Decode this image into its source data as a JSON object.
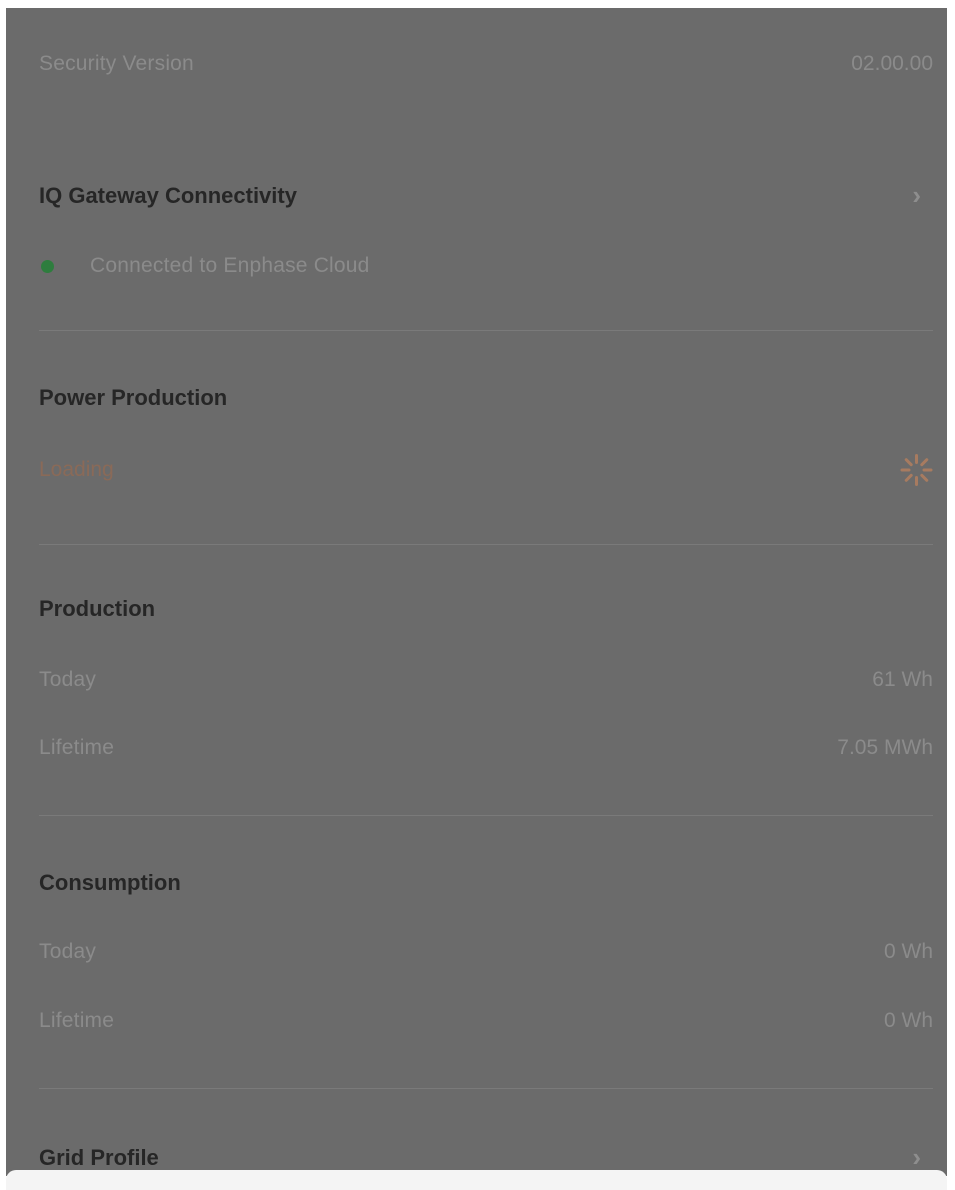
{
  "security": {
    "label": "Security Version",
    "value": "02.00.00"
  },
  "gateway": {
    "title": "IQ Gateway Connectivity",
    "status_text": "Connected to Enphase Cloud",
    "status_color": "#2e7d3e"
  },
  "power_production": {
    "title": "Power Production",
    "status": "Loading",
    "spinner_icon": "loading-spinner-icon"
  },
  "production": {
    "title": "Production",
    "today_label": "Today",
    "today_value": "61 Wh",
    "lifetime_label": "Lifetime",
    "lifetime_value": "7.05 MWh"
  },
  "consumption": {
    "title": "Consumption",
    "today_label": "Today",
    "today_value": "0 Wh",
    "lifetime_label": "Lifetime",
    "lifetime_value": "0 Wh"
  },
  "grid_profile": {
    "title": "Grid Profile"
  },
  "colors": {
    "overlay": "#6b6b6b",
    "accent_loading": "#a77b60"
  }
}
